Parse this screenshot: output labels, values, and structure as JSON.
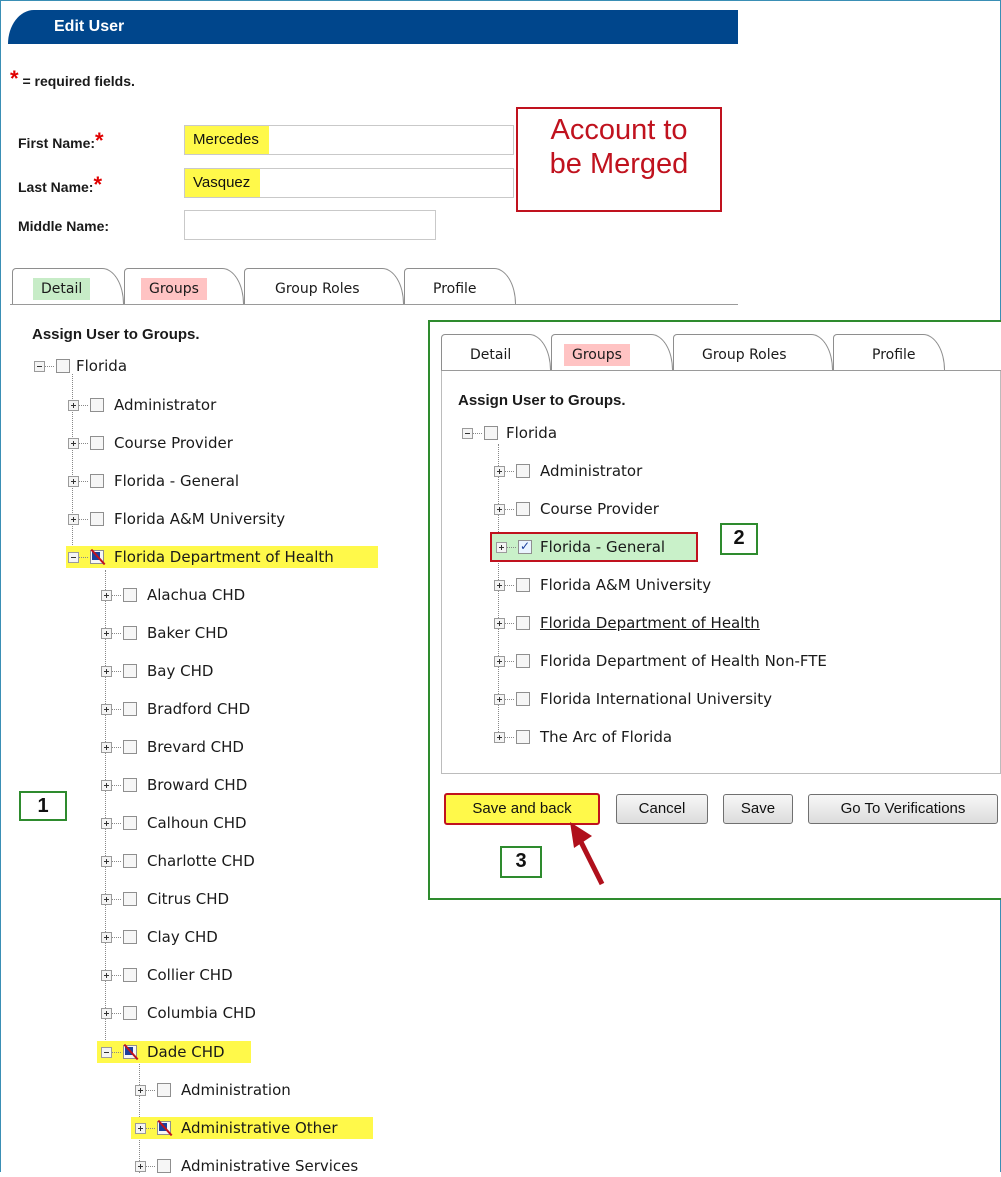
{
  "page": {
    "title": "Edit User",
    "required_note": "= required fields.",
    "required_star": "*"
  },
  "form": {
    "first_name_label": "First Name:",
    "first_name_value": "Mercedes",
    "last_name_label": "Last Name:",
    "last_name_value": "Vasquez",
    "middle_name_label": "Middle Name:",
    "middle_name_value": ""
  },
  "callout": {
    "line1": "Account to",
    "line2": "be Merged"
  },
  "tabs": [
    {
      "label": "Detail"
    },
    {
      "label": "Groups"
    },
    {
      "label": "Group Roles"
    },
    {
      "label": "Profile"
    }
  ],
  "tree": {
    "title": "Assign User to Groups.",
    "root": "Florida",
    "level1": [
      "Administrator",
      "Course Provider",
      "Florida - General",
      "Florida A&M University",
      "Florida Department of Health"
    ],
    "level2": [
      "Alachua CHD",
      "Baker CHD",
      "Bay CHD",
      "Bradford CHD",
      "Brevard CHD",
      "Broward CHD",
      "Calhoun CHD",
      "Charlotte CHD",
      "Citrus CHD",
      "Clay CHD",
      "Collier CHD",
      "Columbia CHD",
      "Dade CHD"
    ],
    "level3": [
      "Administration",
      "Administrative Other",
      "Administrative Services"
    ]
  },
  "inset": {
    "tabs": [
      {
        "label": "Detail"
      },
      {
        "label": "Groups"
      },
      {
        "label": "Group Roles"
      },
      {
        "label": "Profile"
      }
    ],
    "tree_title": "Assign User to Groups.",
    "root": "Florida",
    "items": [
      "Administrator",
      "Course Provider",
      "Florida - General",
      "Florida A&M University",
      "Florida Department of Health",
      "Florida Department of Health Non-FTE",
      "Florida International University",
      "The Arc of Florida"
    ],
    "buttons": {
      "save_and_back": "Save and back",
      "cancel": "Cancel",
      "save": "Save",
      "go_to_verifications": "Go To Verifications"
    }
  },
  "annotations": {
    "step1": "1",
    "step2": "2",
    "step3": "3"
  },
  "colors": {
    "header": "#00468c",
    "highlight": "#fff94a",
    "callout_red": "#c0121e",
    "annotation_green": "#2e8b2e"
  }
}
